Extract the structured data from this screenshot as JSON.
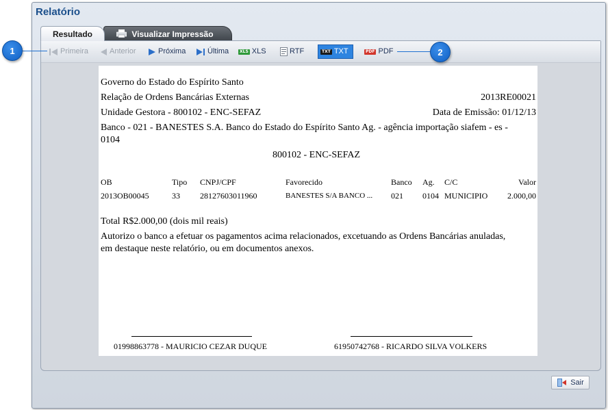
{
  "window": {
    "title": "Relatório"
  },
  "tabs": [
    {
      "label": "Resultado"
    },
    {
      "label": "Visualizar Impressão"
    }
  ],
  "toolbar": {
    "first": "Primeira",
    "previous": "Anterior",
    "next": "Próxima",
    "last": "Última",
    "xls": "XLS",
    "rtf": "RTF",
    "txt": "TXT",
    "pdf": "PDF"
  },
  "report": {
    "gov": "Governo do Estado do Espírito Santo",
    "relation": "Relação de Ordens Bancárias Externas",
    "doc_number": "2013RE00021",
    "unit": "Unidade Gestora - 800102 - ENC-SEFAZ",
    "emission": "Data de Emissão: 01/12/13",
    "bank_line1": "Banco - 021 - BANESTES S.A. Banco do Estado do Espírito Santo Ag. - agência importação siafem - es -",
    "bank_line2": "0104",
    "unit_center": "800102 - ENC-SEFAZ",
    "columns": [
      "OB",
      "Tipo",
      "CNPJ/CPF",
      "Favorecido",
      "Banco",
      "Ag.",
      "C/C",
      "Valor"
    ],
    "rows": [
      [
        "2013OB00045",
        "33",
        "28127603011960",
        "BANESTES S/A BANCO ...",
        "021",
        "0104",
        "MUNICIPIO",
        "2.000,00"
      ]
    ],
    "total": "Total R$2.000,00 (dois mil reais)",
    "auth_line1": "Autorizo o banco a efetuar os pagamentos acima relacionados, excetuando as Ordens Bancárias anuladas,",
    "auth_line2": "em destaque neste relatório, ou em documentos anexos.",
    "signature1": "01998863778 - MAURICIO CEZAR DUQUE",
    "signature2": "61950742768 - RICARDO SILVA VOLKERS"
  },
  "footer": {
    "exit": "Sair"
  },
  "callouts": [
    "1",
    "2"
  ],
  "colors": {
    "title": "#1b4f8b",
    "active_button": "#2e84e0",
    "callout": "#1e6fd0"
  }
}
